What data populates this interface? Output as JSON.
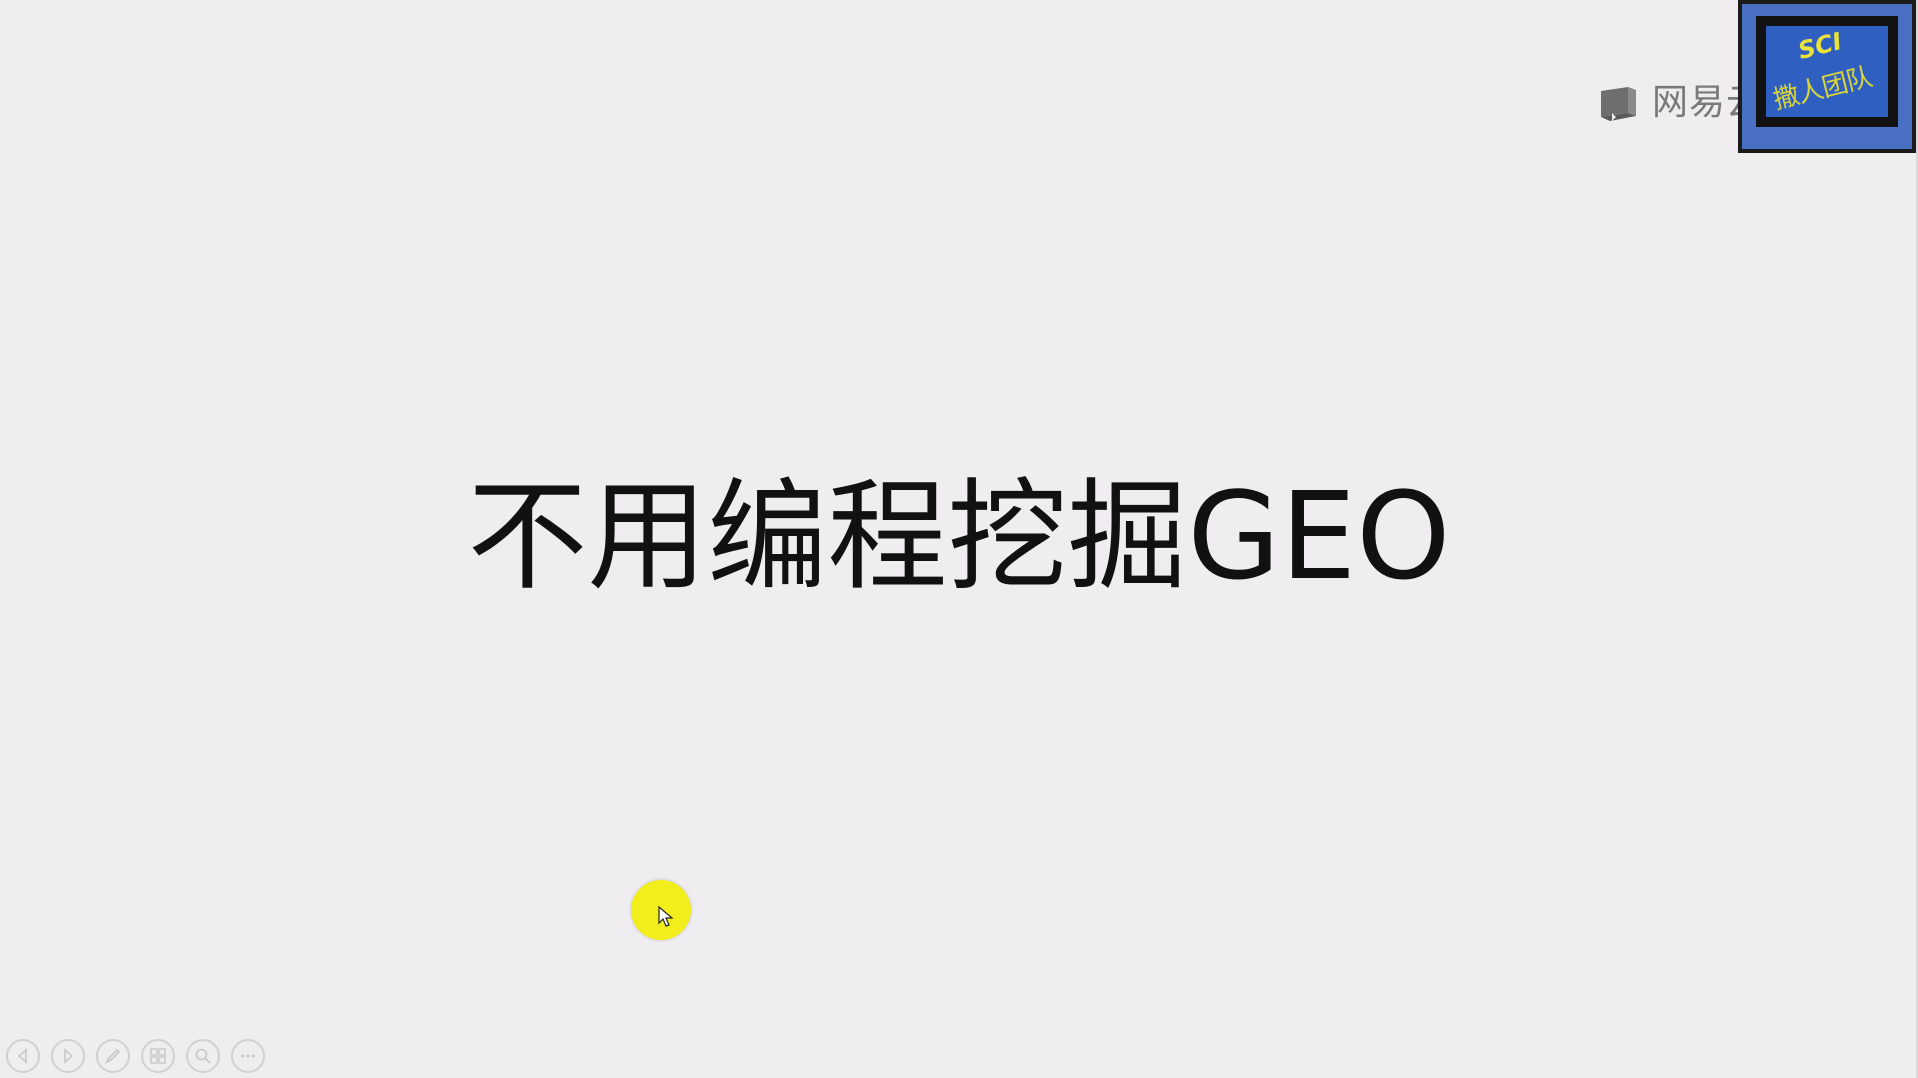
{
  "slide": {
    "title": "不用编程挖掘GEO"
  },
  "watermark": {
    "text": "网易云课堂",
    "icon": "book-icon"
  },
  "logo": {
    "line1": "SCI",
    "line2": "撒人团队"
  },
  "toolbar": {
    "buttons": [
      {
        "icon": "previous-icon"
      },
      {
        "icon": "next-icon"
      },
      {
        "icon": "pen-icon"
      },
      {
        "icon": "slides-grid-icon"
      },
      {
        "icon": "zoom-icon"
      },
      {
        "icon": "more-icon"
      }
    ]
  },
  "colors": {
    "background": "#efedef",
    "title": "#111111",
    "cursor_highlight": "#f2ee1c",
    "logo_blue": "#2f5fc0",
    "logo_text": "#e8e23a"
  }
}
